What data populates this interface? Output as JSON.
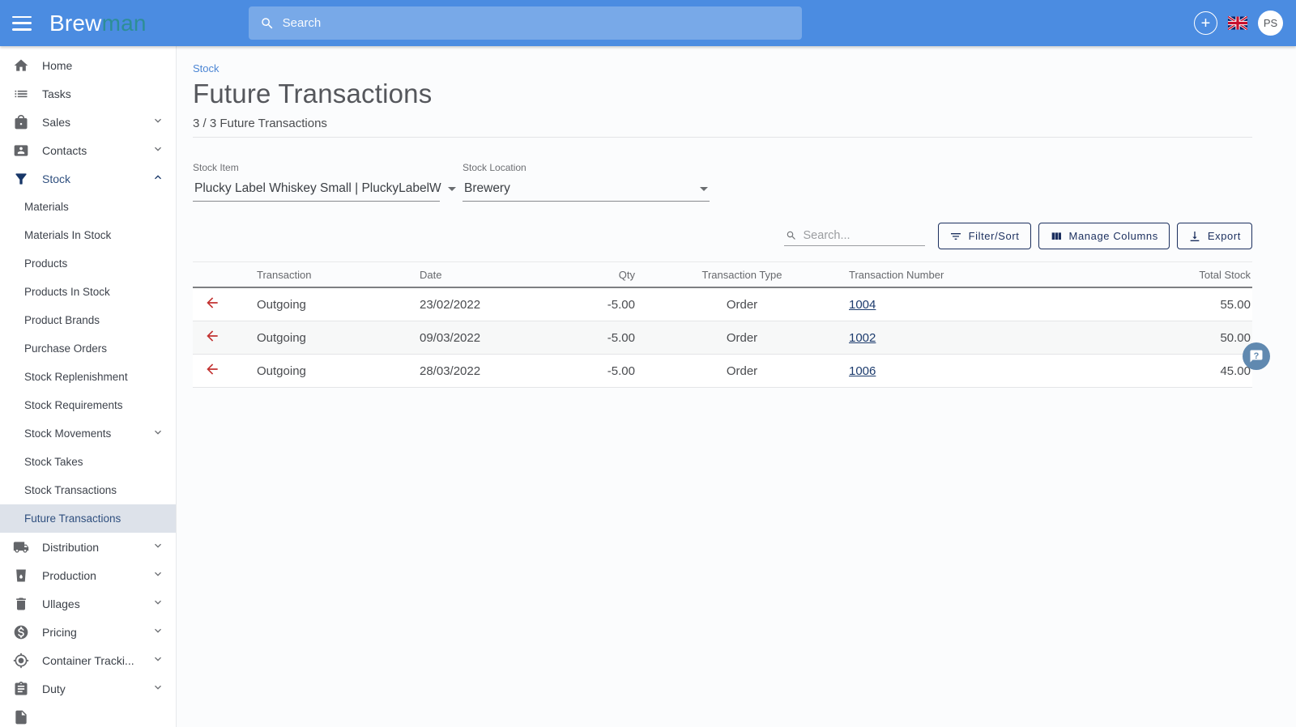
{
  "colors": {
    "topbar_blue": "#4b8ce1",
    "logo_teal": "#2d8e96",
    "accent_navy": "#1b2f5e",
    "link_navy": "#1d3c6e",
    "arrow_red": "#c23230",
    "active_item_bg": "#dde2ea",
    "breadcrumb_blue": "#4c86d4"
  },
  "topbar": {
    "logo_brew": "Brew",
    "logo_man": "man",
    "search_placeholder": "Search",
    "avatar_initials": "PS"
  },
  "sidebar": {
    "items": [
      {
        "label": "Home",
        "icon": "home",
        "type": "top"
      },
      {
        "label": "Tasks",
        "icon": "tasks",
        "type": "top"
      },
      {
        "label": "Sales",
        "icon": "sales",
        "type": "top",
        "chevron": "down"
      },
      {
        "label": "Contacts",
        "icon": "contacts",
        "type": "top",
        "chevron": "down"
      },
      {
        "label": "Stock",
        "icon": "stock",
        "type": "top",
        "chevron": "up",
        "active": true
      },
      {
        "label": "Materials",
        "type": "sub"
      },
      {
        "label": "Materials In Stock",
        "type": "sub"
      },
      {
        "label": "Products",
        "type": "sub"
      },
      {
        "label": "Products In Stock",
        "type": "sub"
      },
      {
        "label": "Product Brands",
        "type": "sub"
      },
      {
        "label": "Purchase Orders",
        "type": "sub"
      },
      {
        "label": "Stock Replenishment",
        "type": "sub"
      },
      {
        "label": "Stock Requirements",
        "type": "sub"
      },
      {
        "label": "Stock Movements",
        "type": "sub",
        "chevron": "down"
      },
      {
        "label": "Stock Takes",
        "type": "sub"
      },
      {
        "label": "Stock Transactions",
        "type": "sub"
      },
      {
        "label": "Future Transactions",
        "type": "sub",
        "active": true
      },
      {
        "label": "Distribution",
        "icon": "distribution",
        "type": "top",
        "chevron": "down"
      },
      {
        "label": "Production",
        "icon": "production",
        "type": "top",
        "chevron": "down"
      },
      {
        "label": "Ullages",
        "icon": "ullages",
        "type": "top",
        "chevron": "down"
      },
      {
        "label": "Pricing",
        "icon": "pricing",
        "type": "top",
        "chevron": "down"
      },
      {
        "label": "Container Tracki...",
        "icon": "container",
        "type": "top",
        "chevron": "down"
      },
      {
        "label": "Duty",
        "icon": "duty",
        "type": "top",
        "chevron": "down"
      },
      {
        "label": "",
        "icon": "report",
        "type": "top"
      }
    ]
  },
  "page": {
    "breadcrumb": "Stock",
    "title": "Future Transactions",
    "count_text": "3 / 3 Future Transactions"
  },
  "filters": {
    "stock_item": {
      "label": "Stock Item",
      "value": "Plucky Label Whiskey Small | PluckyLabelW"
    },
    "stock_location": {
      "label": "Stock Location",
      "value": "Brewery"
    }
  },
  "toolbar": {
    "search_placeholder": "Search...",
    "filter_sort_label": "Filter/Sort",
    "manage_columns_label": "Manage Columns",
    "export_label": "Export"
  },
  "table": {
    "columns": [
      "",
      "Transaction",
      "Date",
      "Qty",
      "Transaction Type",
      "Transaction Number",
      "Total Stock"
    ],
    "rows": [
      {
        "transaction": "Outgoing",
        "date": "23/02/2022",
        "qty": "-5.00",
        "type": "Order",
        "number": "1004",
        "total": "55.00"
      },
      {
        "transaction": "Outgoing",
        "date": "09/03/2022",
        "qty": "-5.00",
        "type": "Order",
        "number": "1002",
        "total": "50.00"
      },
      {
        "transaction": "Outgoing",
        "date": "28/03/2022",
        "qty": "-5.00",
        "type": "Order",
        "number": "1006",
        "total": "45.00"
      }
    ]
  },
  "help": {
    "label": "?"
  }
}
